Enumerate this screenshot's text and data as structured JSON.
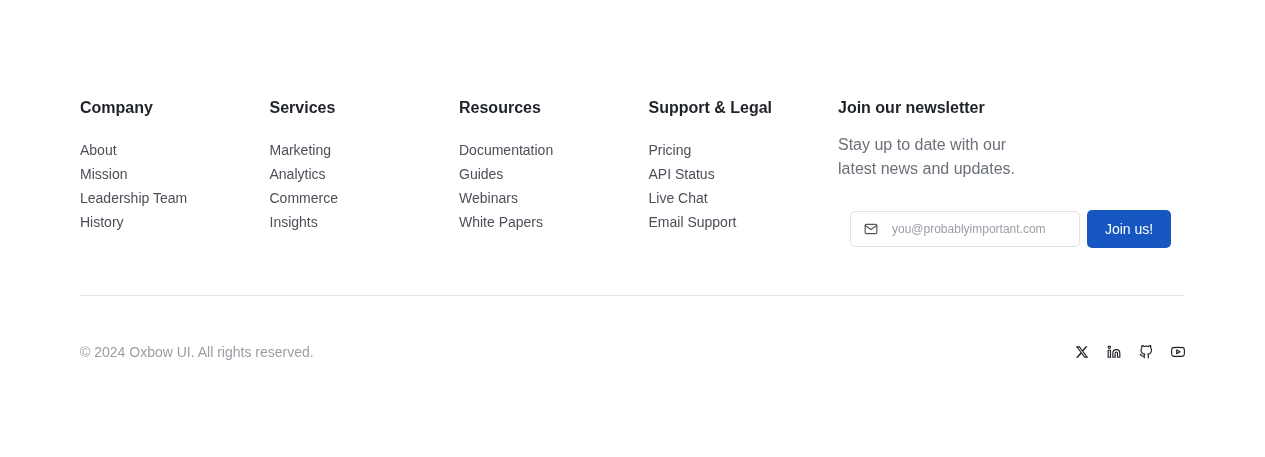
{
  "columns": [
    {
      "heading": "Company",
      "links": [
        "About",
        "Mission",
        "Leadership Team",
        "History"
      ]
    },
    {
      "heading": "Services",
      "links": [
        "Marketing",
        "Analytics",
        "Commerce",
        "Insights"
      ]
    },
    {
      "heading": "Resources",
      "links": [
        "Documentation",
        "Guides",
        "Webinars",
        "White Papers"
      ]
    },
    {
      "heading": "Support & Legal",
      "links": [
        "Pricing",
        "API Status",
        "Live Chat",
        "Email Support"
      ]
    }
  ],
  "newsletter": {
    "heading": "Join our newsletter",
    "text": "Stay up to date with our latest news and updates.",
    "email": {
      "placeholder": "you@probablyimportant.com"
    },
    "button": "Join us!"
  },
  "copyright": "© 2024 Oxbow UI. All rights reserved.",
  "social": [
    {
      "kind": "x"
    },
    {
      "kind": "linkedin"
    },
    {
      "kind": "github"
    },
    {
      "kind": "youtube"
    }
  ]
}
